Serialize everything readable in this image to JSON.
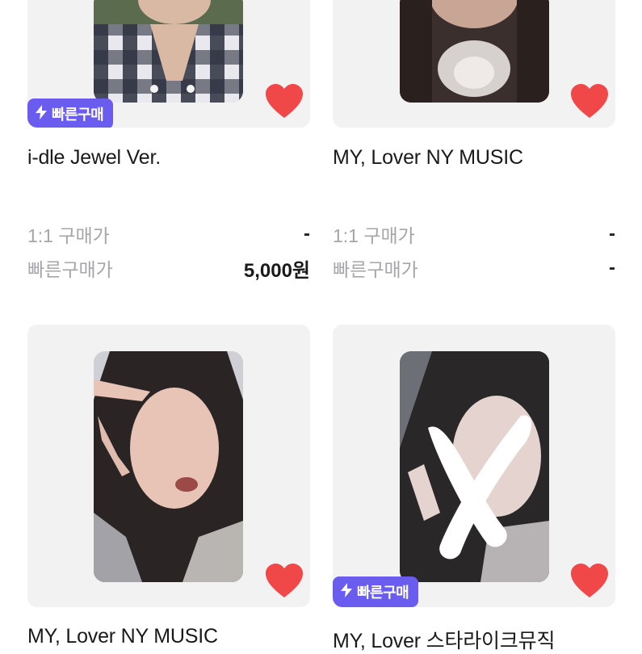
{
  "products": [
    {
      "title": "i-dle Jewel Ver.",
      "badge": "빠른구매",
      "liked": true,
      "prices": [
        {
          "label": "1:1 구매가",
          "value": "-"
        },
        {
          "label": "빠른구매가",
          "value": "5,000원"
        }
      ]
    },
    {
      "title": "MY, Lover NY MUSIC",
      "badge": "",
      "liked": true,
      "prices": [
        {
          "label": "1:1 구매가",
          "value": "-"
        },
        {
          "label": "빠른구매가",
          "value": "-"
        }
      ]
    },
    {
      "title": "MY, Lover NY MUSIC",
      "badge": "",
      "liked": true
    },
    {
      "title": "MY, Lover 스타라이크뮤직",
      "badge": "빠른구매",
      "liked": true
    }
  ],
  "colors": {
    "badge_bg": "#6b5cf0",
    "heart": "#f04848",
    "card_bg": "#f2f2f3"
  },
  "icons": {
    "badge_icon": "lightning-bolt-icon",
    "like_icon": "heart-icon"
  }
}
